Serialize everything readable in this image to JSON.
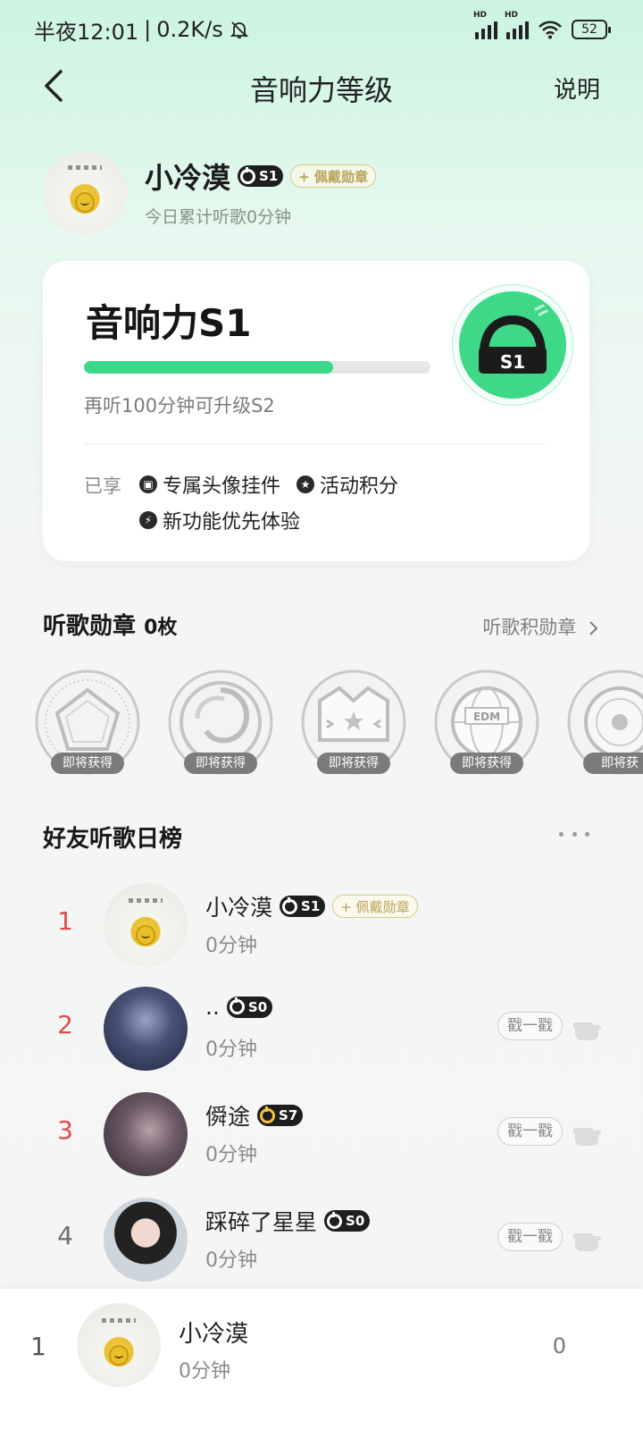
{
  "status": {
    "time": "半夜12:01",
    "speed": "0.2K/s",
    "battery": "52"
  },
  "nav": {
    "title": "音响力等级",
    "help": "说明"
  },
  "profile": {
    "name": "小冷漠",
    "level": "S1",
    "wear_chip": "+ 佩戴勋章",
    "today": "今日累计听歌0分钟"
  },
  "card": {
    "title": "音响力S1",
    "progress": 0.72,
    "hint": "再听100分钟可升级S2",
    "emblem_level": "S1",
    "perks_label": "已享",
    "perks": [
      {
        "icon": "avatar-frame-icon",
        "label": "专属头像挂件"
      },
      {
        "icon": "star-icon",
        "label": "活动积分"
      },
      {
        "icon": "lightning-icon",
        "label": "新功能优先体验"
      }
    ],
    "accent": "#3ad98a"
  },
  "badges_section": {
    "title": "听歌勋章",
    "count": "0枚",
    "link": "听歌积勋章",
    "items": [
      {
        "icon": "pentagon-medal-icon",
        "status": "即将获得"
      },
      {
        "icon": "swirl-medal-icon",
        "status": "即将获得"
      },
      {
        "icon": "crown-medal-icon",
        "status": "即将获得"
      },
      {
        "icon": "globe-medal-icon",
        "status": "即将获得"
      },
      {
        "icon": "vinyl-medal-icon",
        "status": "即将获"
      }
    ],
    "medal_tags": [
      "EDM"
    ]
  },
  "ranking": {
    "title": "好友听歌日榜",
    "poke_label": "戳一戳",
    "rows": [
      {
        "rank": "1",
        "name": "小冷漠",
        "level": "S1",
        "wear_chip": "+ 佩戴勋章",
        "time": "0分钟"
      },
      {
        "rank": "2",
        "name": "..",
        "level": "S0",
        "time": "0分钟"
      },
      {
        "rank": "3",
        "name": "僢途",
        "level": "S7",
        "time": "0分钟"
      },
      {
        "rank": "4",
        "name": "踩碎了星星",
        "level": "S0",
        "time": "0分钟"
      }
    ]
  },
  "self_rank": {
    "rank": "1",
    "name": "小冷漠",
    "time": "0分钟",
    "value": "0"
  }
}
